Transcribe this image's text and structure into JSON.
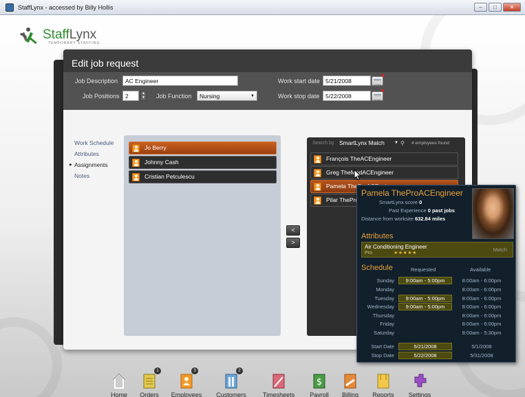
{
  "window": {
    "title": "StaffLynx - accessed by Billy Hollis"
  },
  "logo": {
    "name_a": "Staff",
    "name_b": "Lynx",
    "tagline": "TEMPORARY STAFFING"
  },
  "dialog": {
    "title": "Edit job request",
    "job_description_label": "Job Description",
    "job_description_value": "AC Engineer",
    "job_positions_label": "Job Positions",
    "job_positions_value": "2",
    "job_function_label": "Job Function",
    "job_function_value": "Nursing",
    "work_start_label": "Work start date",
    "work_start_value": "5/21/2008",
    "work_stop_label": "Work stop date",
    "work_stop_value": "5/22/2008"
  },
  "nav": [
    "Work Schedule",
    "Attributes",
    "Assignments",
    "Notes"
  ],
  "assigned": [
    "Jo Berry",
    "Johnny Cash",
    "Cristian Petculescu"
  ],
  "move_left": "<",
  "move_right": ">",
  "search": {
    "label": "Search by",
    "mode": "SmartLynx Match",
    "count": "4 employees found"
  },
  "candidates": [
    "François TheACEngineer",
    "Greg TheMedACEngineer",
    "Pamela TheProACEngineer",
    "Pilar TheProACG..."
  ],
  "tooltip": {
    "name": "Pamela TheProACEngineer",
    "score_label": "SmartLynx score",
    "score": "0",
    "experience_label": "Past Experience",
    "experience": "0 past jobs",
    "distance_label": "Distance from worksite",
    "distance": "632.84 miles",
    "attributes_title": "Attributes",
    "attribute": {
      "name": "Air Conditioning Engineer",
      "level": "Pro",
      "stars": "★★★★★",
      "match": "Match"
    },
    "schedule_title": "Schedule",
    "requested_label": "Requested",
    "available_label": "Available",
    "schedule": [
      {
        "day": "Sunday",
        "requested": "9:00am - 5:00pm",
        "available": "8:00am - 6:00pm"
      },
      {
        "day": "Monday",
        "requested": "",
        "available": "8:00am - 6:00pm"
      },
      {
        "day": "Tuesday",
        "requested": "9:00am - 5:00pm",
        "available": "8:00am - 6:00pm"
      },
      {
        "day": "Wednesday",
        "requested": "9:00am - 5:00pm",
        "available": "8:00am - 6:00pm"
      },
      {
        "day": "Thursday",
        "requested": "",
        "available": "8:00am - 6:00pm"
      },
      {
        "day": "Friday",
        "requested": "",
        "available": "8:00am - 6:00pm"
      },
      {
        "day": "Saturday",
        "requested": "",
        "available": "8:00am - 5:30pm"
      }
    ],
    "start_label": "Start Date",
    "start_req": "5/21/2008",
    "start_avail": "5/1/2008",
    "stop_label": "Stop Date",
    "stop_req": "5/22/2008",
    "stop_avail": "5/31/2008"
  },
  "toolbar": {
    "home": "Home",
    "orders": "Orders",
    "employees": "Employees",
    "customers": "Customers",
    "timesheets": "Timesheets",
    "payroll": "Payroll",
    "billing": "Billing",
    "reports": "Reports",
    "settings": "Settings",
    "orders_badge": "1",
    "employees_badge": "3",
    "customers_badge": "2"
  },
  "colors": {
    "accent_orange": "#c8601f",
    "dialog_dark": "#3b3b3b",
    "logo_green": "#2e8b2e",
    "tooltip_bg": "#12202c",
    "tooltip_heading": "#e8a13a"
  }
}
